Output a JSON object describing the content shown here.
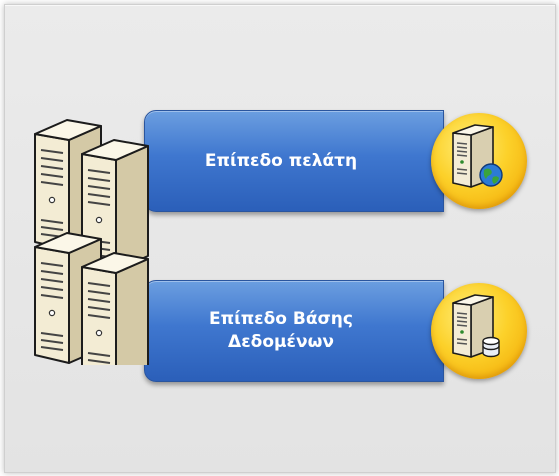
{
  "diagram": {
    "tiers": [
      {
        "label_lines": [
          "Επίπεδο πελάτη"
        ],
        "icon": "web-server-icon"
      },
      {
        "label_lines": [
          "Επίπεδο Βάσης",
          "Δεδομένων"
        ],
        "icon": "database-server-icon"
      }
    ],
    "left_icon": "server-cluster-icon",
    "colors": {
      "bar": "#3f77cf",
      "badge": "#fcd12a",
      "server_body": "#f1ead3",
      "server_outline": "#1c1c1c",
      "background": "#e6e6e6"
    }
  }
}
